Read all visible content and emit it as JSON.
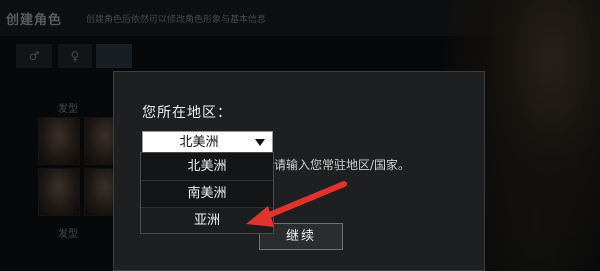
{
  "background": {
    "title": "创建角色",
    "subtitle": "创建角色后依然可以修改角色形象与基本信息",
    "section_labels": [
      "发型",
      "发型"
    ]
  },
  "dialog": {
    "title": "您所在地区：",
    "description": "为了改进您的游戏体验，请输入您常驻地区/国家。",
    "selected_region": "北美洲",
    "options": [
      "北美洲",
      "南美洲",
      "亚洲"
    ],
    "continue_label": "继续"
  },
  "colors": {
    "annotation_arrow": "#e0332b",
    "dialog_bg": "#1e1f20"
  },
  "icons": {
    "dropdown": "triangle-down-icon",
    "annotation": "red-arrow-icon"
  }
}
